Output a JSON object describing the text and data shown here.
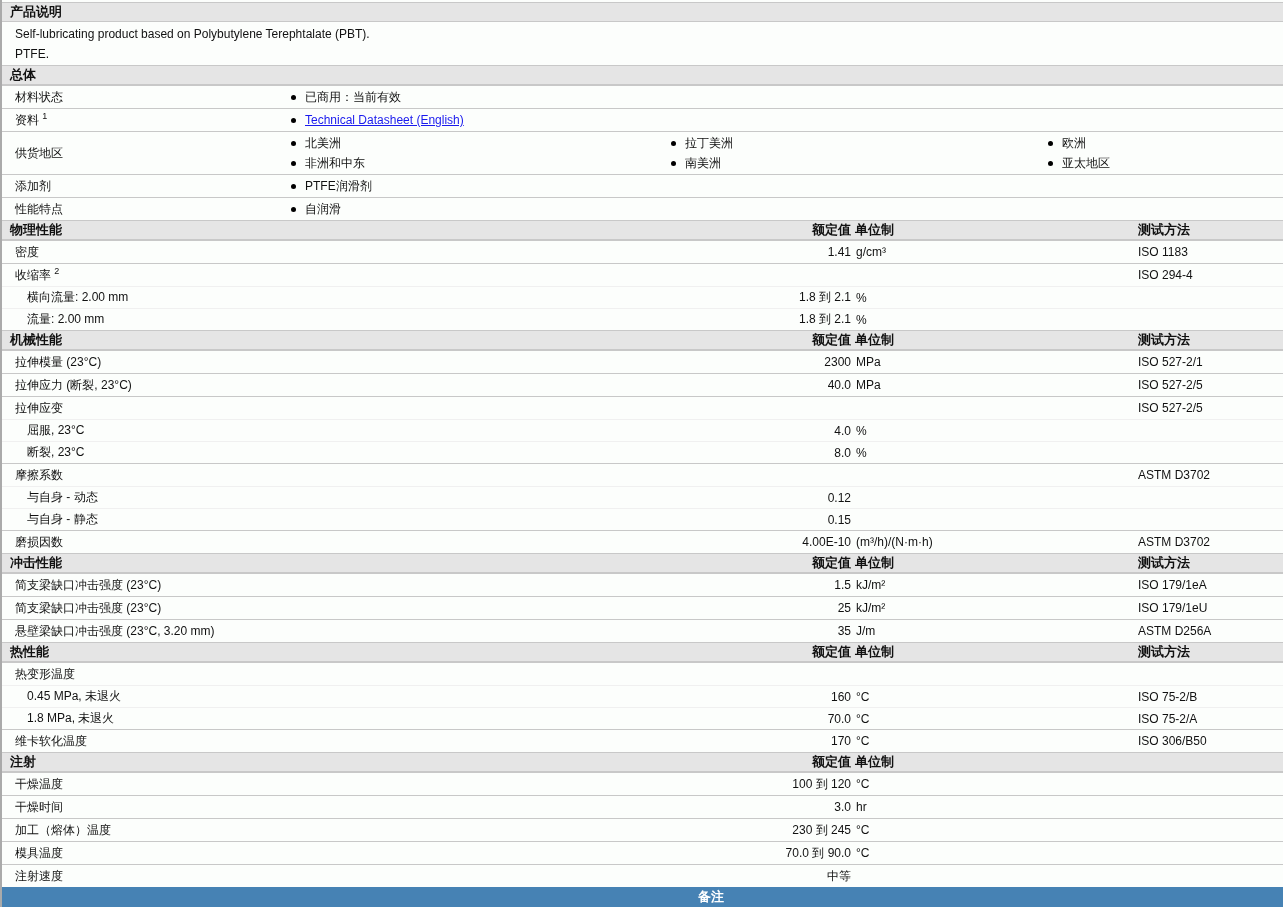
{
  "sections": [
    {
      "kind": "text",
      "title": "产品说明",
      "lines": [
        "Self-lubricating product based on Polybutylene Terephtalate (PBT).",
        "PTFE."
      ]
    },
    {
      "kind": "list",
      "title": "总体",
      "rows": [
        {
          "label": "材料状态",
          "items": [
            {
              "kind": "text",
              "text": "已商用：当前有效"
            }
          ]
        },
        {
          "label": "资料 $^{1}$",
          "items": [
            {
              "kind": "link",
              "text": "Technical Datasheet (English)"
            }
          ]
        },
        {
          "label": "供货地区",
          "items": [
            {
              "kind": "text",
              "text": "北美洲"
            },
            {
              "kind": "text",
              "text": "拉丁美洲"
            },
            {
              "kind": "text",
              "text": "欧洲"
            },
            {
              "kind": "text",
              "text": "非洲和中东"
            },
            {
              "kind": "text",
              "text": "南美洲"
            },
            {
              "kind": "text",
              "text": "亚太地区"
            }
          ]
        },
        {
          "label": "添加剂",
          "items": [
            {
              "kind": "text",
              "text": "PTFE润滑剂"
            }
          ]
        },
        {
          "label": "性能特点",
          "items": [
            {
              "kind": "text",
              "text": "自润滑"
            }
          ]
        }
      ]
    },
    {
      "kind": "props",
      "title": "物理性能",
      "value_header": "额定值",
      "unit_header": "单位制",
      "method_header": "测试方法",
      "rows": [
        {
          "label": "密度",
          "value": "1.41",
          "unit": "g/cm³",
          "method": "ISO 1183"
        },
        {
          "label": "收缩率 $^{2}$",
          "method": "ISO 294-4",
          "children": [
            {
              "label": "横向流量: 2.00 mm",
              "value": "1.8 到 2.1",
              "unit": "%"
            },
            {
              "label": "流量: 2.00 mm",
              "value": "1.8 到 2.1",
              "unit": "%"
            }
          ]
        }
      ]
    },
    {
      "kind": "props",
      "title": "机械性能",
      "value_header": "额定值",
      "unit_header": "单位制",
      "method_header": "测试方法",
      "rows": [
        {
          "label": "拉伸模量 (23°C)",
          "value": "2300",
          "unit": "MPa",
          "method": "ISO 527-2/1"
        },
        {
          "label": "拉伸应力 (断裂, 23°C)",
          "value": "40.0",
          "unit": "MPa",
          "method": "ISO 527-2/5"
        },
        {
          "label": "拉伸应变",
          "method": "ISO 527-2/5",
          "children": [
            {
              "label": "屈服, 23°C",
              "value": "4.0",
              "unit": "%"
            },
            {
              "label": "断裂, 23°C",
              "value": "8.0",
              "unit": "%"
            }
          ]
        },
        {
          "label": "摩擦系数",
          "method": "ASTM D3702",
          "children": [
            {
              "label": "与自身 - 动态",
              "value": "0.12"
            },
            {
              "label": "与自身 - 静态",
              "value": "0.15"
            }
          ]
        },
        {
          "label": "磨损因数",
          "value": "4.00E-10",
          "unit": "(m³/h)/(N·m·h)",
          "method": "ASTM D3702"
        }
      ]
    },
    {
      "kind": "props",
      "title": "冲击性能",
      "value_header": "额定值",
      "unit_header": "单位制",
      "method_header": "测试方法",
      "rows": [
        {
          "label": "简支梁缺口冲击强度 (23°C)",
          "value": "1.5",
          "unit": "kJ/m²",
          "method": "ISO 179/1eA"
        },
        {
          "label": "简支梁缺口冲击强度 (23°C)",
          "value": "25",
          "unit": "kJ/m²",
          "method": "ISO 179/1eU"
        },
        {
          "label": "悬壁梁缺口冲击强度 (23°C, 3.20 mm)",
          "value": "35",
          "unit": "J/m",
          "method": "ASTM D256A"
        }
      ]
    },
    {
      "kind": "props",
      "title": "热性能",
      "value_header": "额定值",
      "unit_header": "单位制",
      "method_header": "测试方法",
      "rows": [
        {
          "label": "热变形温度",
          "children": [
            {
              "label": "0.45 MPa, 未退火",
              "value": "160",
              "unit": "°C",
              "method": "ISO 75-2/B"
            },
            {
              "label": "1.8 MPa, 未退火",
              "value": "70.0",
              "unit": "°C",
              "method": "ISO 75-2/A"
            }
          ]
        },
        {
          "label": "维卡软化温度",
          "value": "170",
          "unit": "°C",
          "method": "ISO 306/B50"
        }
      ]
    },
    {
      "kind": "props",
      "title": "注射",
      "value_header": "额定值",
      "unit_header": "单位制",
      "rows": [
        {
          "label": "干燥温度",
          "value": "100 到 120",
          "unit": "°C"
        },
        {
          "label": "干燥时间",
          "value": "3.0",
          "unit": "hr"
        },
        {
          "label": "加工（熔体）温度",
          "value": "230 到 245",
          "unit": "°C"
        },
        {
          "label": "模具温度",
          "value": "70.0 到 90.0",
          "unit": "°C"
        },
        {
          "label": "注射速度",
          "value": "中等"
        }
      ]
    },
    {
      "kind": "bar",
      "title": "备注"
    }
  ]
}
